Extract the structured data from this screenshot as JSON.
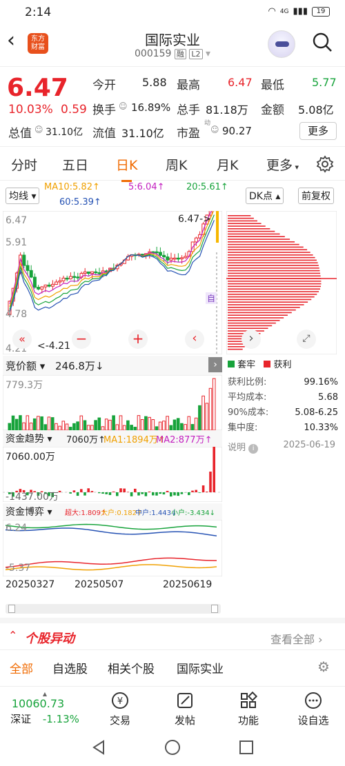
{
  "status_bar": {
    "time": "2:14",
    "network": "4G",
    "battery": "19"
  },
  "header": {
    "logo_line1": "东方",
    "logo_line2": "财富",
    "name": "国际实业",
    "code": "000159",
    "tag1": "融",
    "tag2": "L2"
  },
  "quote": {
    "price": "6.47",
    "change_pct": "10.03%",
    "change": "0.59",
    "open_label": "今开",
    "open": "5.88",
    "high_label": "最高",
    "high": "6.47",
    "low_label": "最低",
    "low": "5.77",
    "turnover_label": "换手",
    "turnover": "16.89%",
    "volume_label": "总手",
    "volume": "81.18万",
    "amount_label": "金额",
    "amount": "5.08亿",
    "mcap_label": "总值",
    "mcap": "31.10亿",
    "float_label": "流值",
    "float_cap": "31.10亿",
    "pe_label": "市盈",
    "pe_sup": "动",
    "pe": "90.27",
    "more": "更多"
  },
  "tabs": [
    "分时",
    "五日",
    "日K",
    "周K",
    "月K",
    "更多"
  ],
  "active_tab": "日K",
  "kchart": {
    "indicator": "均线",
    "ma10": "MA10:5.82↑",
    "ma5": "5:6.04↑",
    "ma20": "20:5.61↑",
    "ma60": "60:5.39↑",
    "dk": "DK点",
    "adj": "前复权",
    "y_top": "6.47",
    "y_2": "5.91",
    "y_3": "4.78",
    "y_low": "4.21",
    "last_label": "6.47->",
    "low_label": "<-4.21",
    "auto": "自"
  },
  "cost_panel": {
    "legend_trap": "套牢",
    "legend_profit": "获利",
    "rows": [
      {
        "label": "获利比例:",
        "value": "99.16%"
      },
      {
        "label": "平均成本:",
        "value": "5.68"
      },
      {
        "label": "90%成本:",
        "value": "5.08-6.25"
      },
      {
        "label": "集中度:",
        "value": "10.33%"
      }
    ],
    "note": "说明",
    "date": "2025-06-19"
  },
  "auction": {
    "label": "竞价额",
    "value": "246.8万↓",
    "top": "779.3万"
  },
  "fund_trend": {
    "label": "资金趋势",
    "value": "7060万↑",
    "ma1": "MA1:1894万↑",
    "ma2": "MA2:877万↑",
    "top": "7060.00万",
    "bottom": "-1437.00万"
  },
  "fund_game": {
    "label": "资金博弈",
    "super": "超大:1.809↑",
    "big": "大户:0.182↑",
    "mid": "中户:1.443↓",
    "small": "小户:-3.434↓",
    "top": "6.24",
    "bottom": "-5.37"
  },
  "x_axis": [
    "20250327",
    "20250507",
    "20250619"
  ],
  "news": {
    "title": "个股异动",
    "more": "查看全部"
  },
  "filter_tabs": [
    "全部",
    "自选股",
    "相关个股",
    "国际实业"
  ],
  "index": {
    "value": "10060.73",
    "name": "深证",
    "change": "-1.13%"
  },
  "bottom_nav": [
    "交易",
    "发帖",
    "功能",
    "设自选"
  ],
  "colors": {
    "up": "#e8242b",
    "down": "#17a33b",
    "accent": "#f06a00"
  }
}
